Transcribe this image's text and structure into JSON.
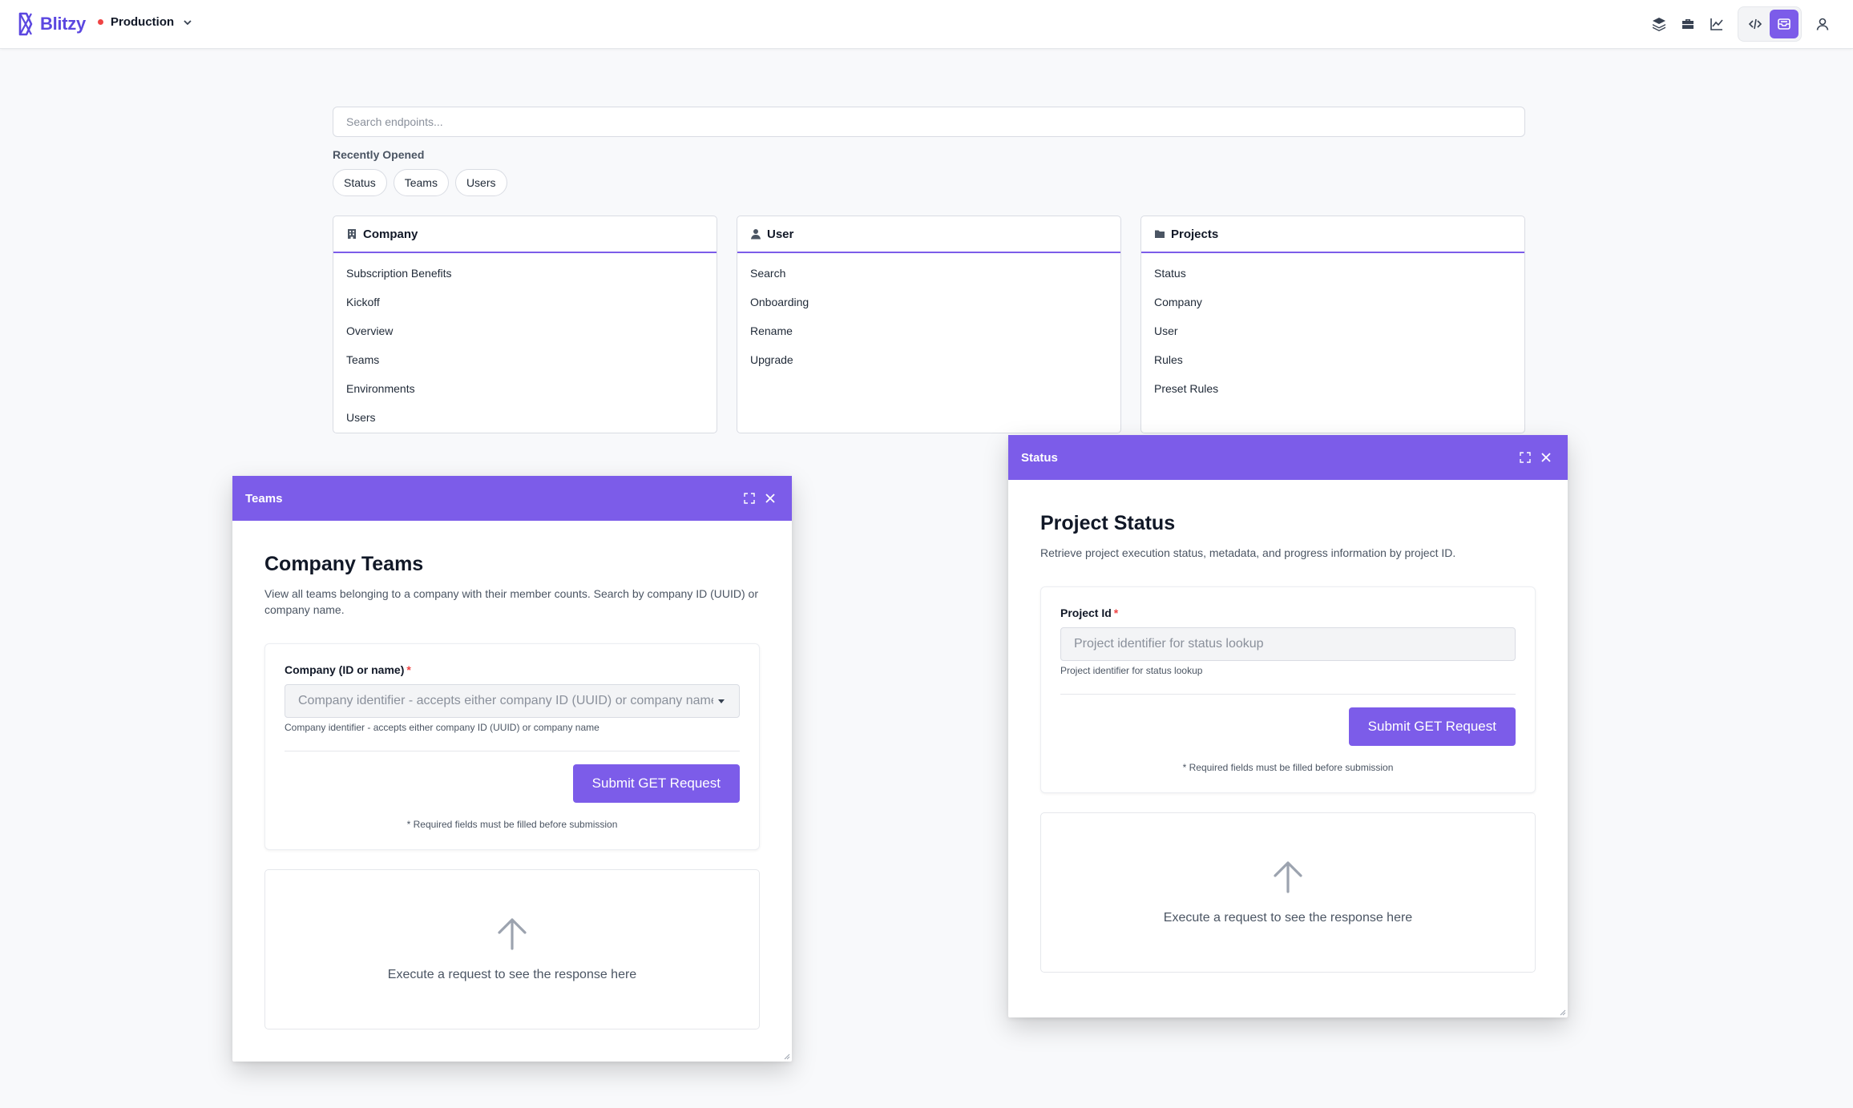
{
  "app": {
    "name": "Blitzy"
  },
  "environment": {
    "label": "Production",
    "status_color": "#ef4444"
  },
  "colors": {
    "accent": "#7c5ce9",
    "brand": "#5b47e0"
  },
  "top_icons": [
    "layers-icon",
    "briefcase-icon",
    "chart-icon",
    "code-icon",
    "inbox-icon",
    "user-icon"
  ],
  "search": {
    "placeholder": "Search endpoints...",
    "value": ""
  },
  "recent": {
    "label": "Recently Opened",
    "items": [
      "Status",
      "Teams",
      "Users"
    ]
  },
  "cards": [
    {
      "title": "Company",
      "icon": "building-icon",
      "items": [
        "Subscription Benefits",
        "Kickoff",
        "Overview",
        "Teams",
        "Environments",
        "Users"
      ]
    },
    {
      "title": "User",
      "icon": "person-icon",
      "items": [
        "Search",
        "Onboarding",
        "Rename",
        "Upgrade"
      ]
    },
    {
      "title": "Projects",
      "icon": "folder-icon",
      "items": [
        "Status",
        "Company",
        "User",
        "Rules",
        "Preset Rules"
      ]
    }
  ],
  "teams_modal": {
    "window_title": "Teams",
    "heading": "Company Teams",
    "description": "View all teams belonging to a company with their member counts. Search by company ID (UUID) or company name.",
    "field_label": "Company (ID or name)",
    "required_mark": "*",
    "field_placeholder": "Company identifier - accepts either company ID (UUID) or company name",
    "field_help": "Company identifier - accepts either company ID (UUID) or company name",
    "submit_label": "Submit GET Request",
    "note": "* Required fields must be filled before submission",
    "response_placeholder": "Execute a request to see the response here"
  },
  "status_modal": {
    "window_title": "Status",
    "heading": "Project Status",
    "description": "Retrieve project execution status, metadata, and progress information by project ID.",
    "field_label": "Project Id",
    "required_mark": "*",
    "field_placeholder": "Project identifier for status lookup",
    "field_help": "Project identifier for status lookup",
    "submit_label": "Submit GET Request",
    "note": "* Required fields must be filled before submission",
    "response_placeholder": "Execute a request to see the response here"
  }
}
